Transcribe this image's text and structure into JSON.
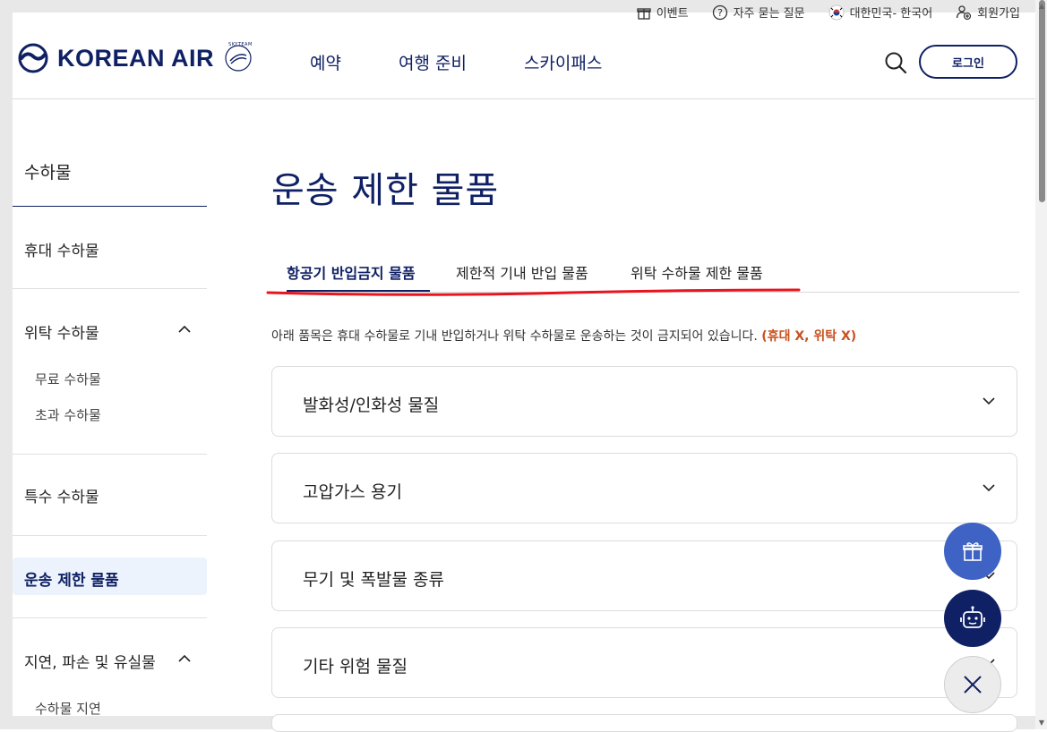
{
  "utility": {
    "items": [
      {
        "label": "이벤트",
        "icon": "gift-icon"
      },
      {
        "label": "자주 묻는 질문",
        "icon": "question-icon"
      },
      {
        "label": "대한민국- 한국어",
        "icon": "korea-flag-icon"
      },
      {
        "label": "회원가입",
        "icon": "user-add-icon"
      }
    ]
  },
  "header": {
    "logo_text": "KOREAN AIR",
    "logo_badge": "SKYTEAM",
    "nav": [
      "예약",
      "여행 준비",
      "스카이패스"
    ],
    "login_label": "로그인"
  },
  "sidebar": {
    "title": "수하물",
    "items": [
      {
        "label": "휴대 수하물"
      },
      {
        "label": "위탁 수하물",
        "expanded": true,
        "children": [
          "무료 수하물",
          "초과 수하물"
        ]
      },
      {
        "label": "특수 수하물"
      },
      {
        "label": "운송 제한 물품",
        "active": true
      },
      {
        "label": "지연, 파손 및 유실물",
        "expanded": true,
        "children": [
          "수하물 지연"
        ]
      }
    ]
  },
  "main": {
    "title": "운송 제한 물품",
    "tabs": [
      {
        "label": "항공기 반입금지 물품",
        "active": true
      },
      {
        "label": "제한적 기내 반입 물품"
      },
      {
        "label": "위탁 수하물 제한 물품"
      }
    ],
    "notice": "아래 품목은 휴대 수하물로 기내 반입하거나 위탁 수하물로 운송하는 것이 금지되어 있습니다. ",
    "notice_highlight": "(휴대 X, 위탁 X)",
    "accordions": [
      {
        "label": "발화성/인화성 물질"
      },
      {
        "label": "고압가스 용기"
      },
      {
        "label": "무기 및 폭발물 종류"
      },
      {
        "label": "기타 위험 물질"
      }
    ]
  },
  "colors": {
    "brand_navy": "#0f2064",
    "accent_orange": "#c8501e",
    "annotation_red": "#e8141e",
    "fab_blue": "#3f63c4"
  }
}
